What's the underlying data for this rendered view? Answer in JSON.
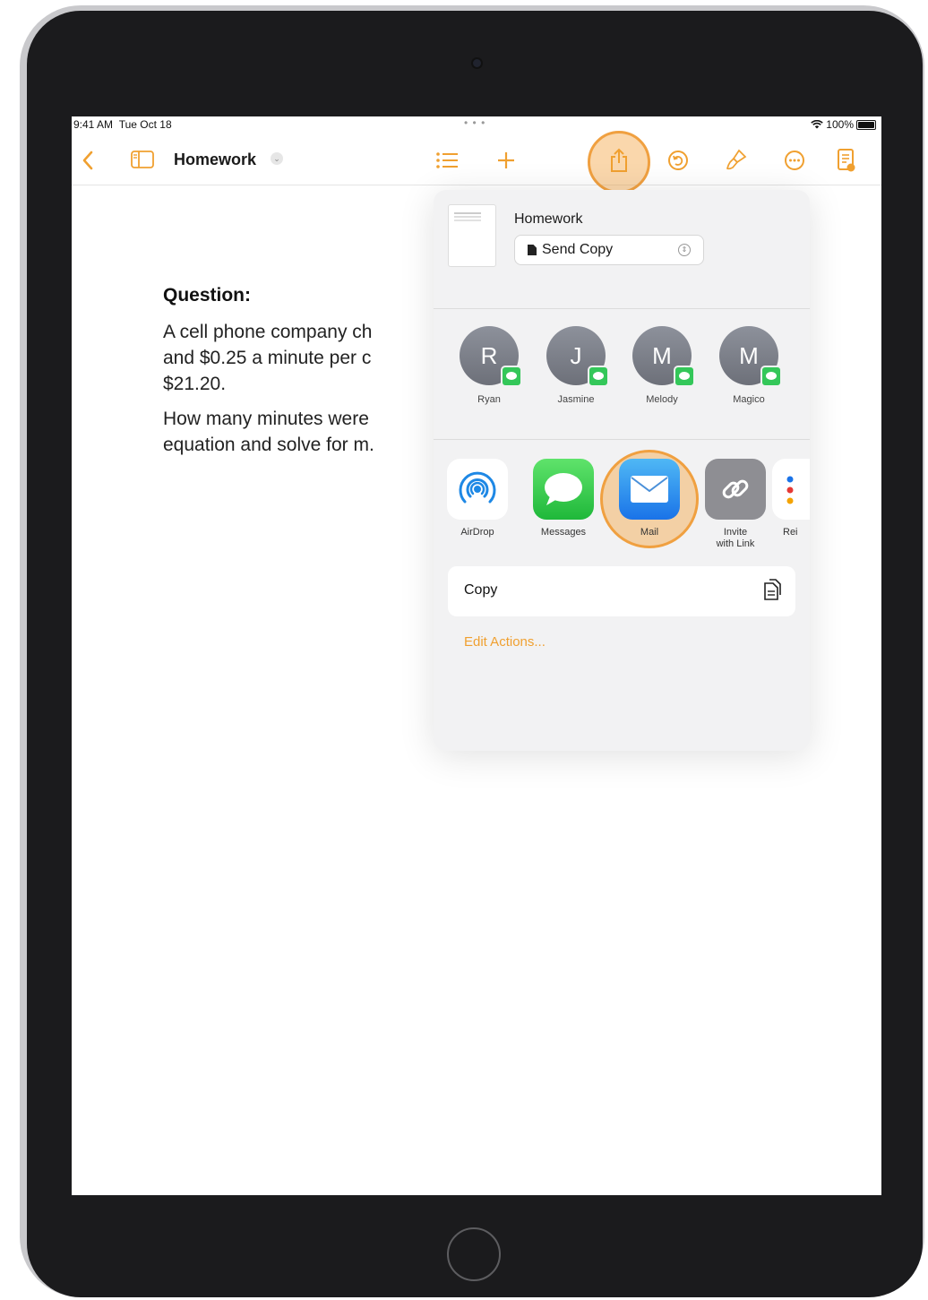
{
  "status_bar": {
    "time": "9:41 AM",
    "date": "Tue Oct 18",
    "dots": "• • •",
    "battery": "100%"
  },
  "toolbar": {
    "back_icon": "chevron-left-icon",
    "title": "Homework",
    "accent_color": "#f0a030"
  },
  "document": {
    "heading": "Question:",
    "paragraph1": "A cell phone company ch\nand $0.25 a minute per c\n$21.20.",
    "paragraph2": "How many minutes were\nequation and solve for m."
  },
  "share_sheet": {
    "title": "Homework",
    "send_option": "Send Copy",
    "people": [
      {
        "initial": "R",
        "name": "Ryan"
      },
      {
        "initial": "J",
        "name": "Jasmine"
      },
      {
        "initial": "M",
        "name": "Melody"
      },
      {
        "initial": "M",
        "name": "Magico"
      }
    ],
    "apps": [
      {
        "name": "AirDrop",
        "icon": "airdrop-icon"
      },
      {
        "name": "Messages",
        "icon": "messages-icon"
      },
      {
        "name": "Mail",
        "icon": "mail-icon"
      },
      {
        "name": "Invite\nwith Link",
        "icon": "link-icon"
      },
      {
        "name": "Rei",
        "icon": "reminders-icon"
      }
    ],
    "copy_label": "Copy",
    "edit_actions": "Edit Actions..."
  }
}
